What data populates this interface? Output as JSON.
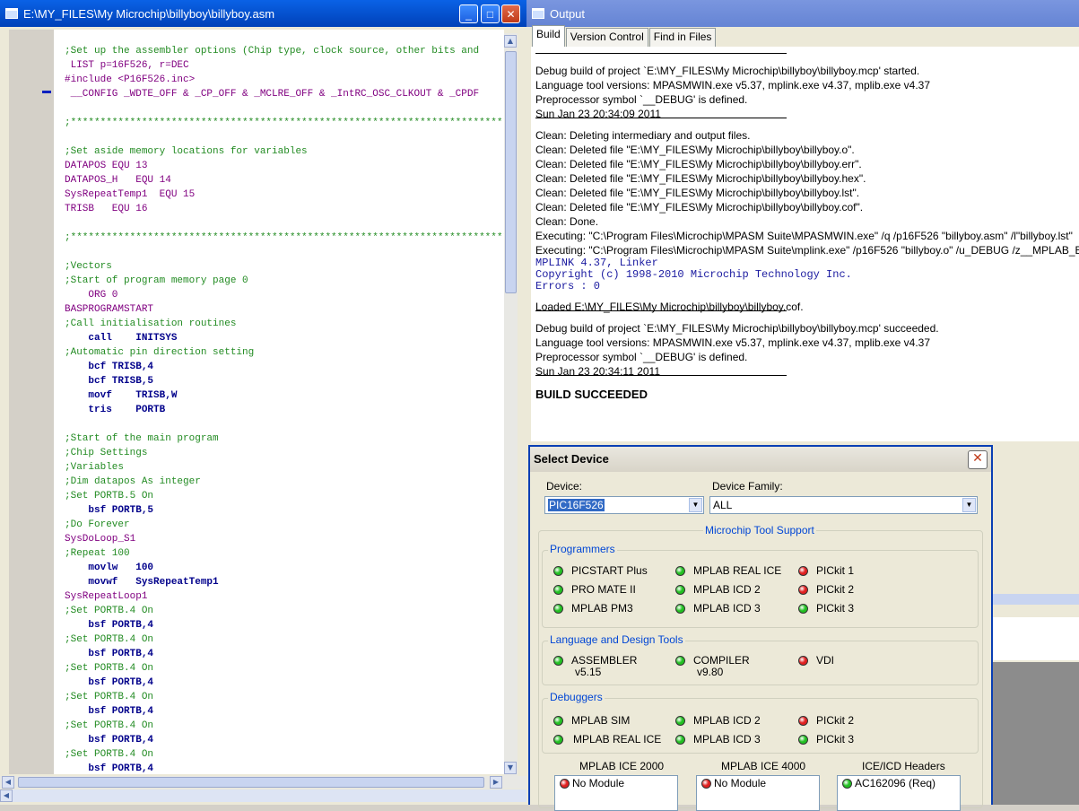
{
  "editor": {
    "title": "E:\\MY_FILES\\My Microchip\\billyboy\\billyboy.asm",
    "lines": [
      {
        "text": ";Set up the assembler options (Chip type, clock source, other bits and",
        "style": "cmt"
      },
      {
        "text": " LIST p=16F526, r=DEC",
        "style": "pp"
      },
      {
        "text": "#include <P16F526.inc>",
        "style": "pp"
      },
      {
        "text": " __CONFIG _WDTE_OFF & _CP_OFF & _MCLRE_OFF & _IntRC_OSC_CLKOUT & _CPDF",
        "style": "pp"
      },
      {
        "text": "",
        "style": "nm"
      },
      {
        "text": ";******************************************************************************",
        "style": "cmt"
      },
      {
        "text": "",
        "style": "nm"
      },
      {
        "text": ";Set aside memory locations for variables",
        "style": "cmt"
      },
      {
        "text": "DATAPOS EQU 13",
        "style": "pp"
      },
      {
        "text": "DATAPOS_H   EQU 14",
        "style": "pp"
      },
      {
        "text": "SysRepeatTemp1  EQU 15",
        "style": "pp"
      },
      {
        "text": "TRISB   EQU 16",
        "style": "pp"
      },
      {
        "text": "",
        "style": "nm"
      },
      {
        "text": ";******************************************************************************",
        "style": "cmt"
      },
      {
        "text": "",
        "style": "nm"
      },
      {
        "text": ";Vectors",
        "style": "cmt"
      },
      {
        "text": ";Start of program memory page 0",
        "style": "cmt"
      },
      {
        "text": "    ORG 0",
        "style": "pp"
      },
      {
        "text": "BASPROGRAMSTART",
        "style": "pp"
      },
      {
        "text": ";Call initialisation routines",
        "style": "cmt"
      },
      {
        "text": "    call    INITSYS",
        "style": "kw"
      },
      {
        "text": ";Automatic pin direction setting",
        "style": "cmt"
      },
      {
        "text": "    bcf TRISB,4",
        "style": "kw"
      },
      {
        "text": "    bcf TRISB,5",
        "style": "kw"
      },
      {
        "text": "    movf    TRISB,W",
        "style": "kw"
      },
      {
        "text": "    tris    PORTB",
        "style": "kw"
      },
      {
        "text": "",
        "style": "nm"
      },
      {
        "text": ";Start of the main program",
        "style": "cmt"
      },
      {
        "text": ";Chip Settings",
        "style": "cmt"
      },
      {
        "text": ";Variables",
        "style": "cmt"
      },
      {
        "text": ";Dim datapos As integer",
        "style": "cmt"
      },
      {
        "text": ";Set PORTB.5 On",
        "style": "cmt"
      },
      {
        "text": "    bsf PORTB,5",
        "style": "kw"
      },
      {
        "text": ";Do Forever",
        "style": "cmt"
      },
      {
        "text": "SysDoLoop_S1",
        "style": "pp"
      },
      {
        "text": ";Repeat 100",
        "style": "cmt"
      },
      {
        "text": "    movlw   100",
        "style": "kw"
      },
      {
        "text": "    movwf   SysRepeatTemp1",
        "style": "kw"
      },
      {
        "text": "SysRepeatLoop1",
        "style": "pp"
      },
      {
        "text": ";Set PORTB.4 On",
        "style": "cmt"
      },
      {
        "text": "    bsf PORTB,4",
        "style": "kw"
      },
      {
        "text": ";Set PORTB.4 On",
        "style": "cmt"
      },
      {
        "text": "    bsf PORTB,4",
        "style": "kw"
      },
      {
        "text": ";Set PORTB.4 On",
        "style": "cmt"
      },
      {
        "text": "    bsf PORTB,4",
        "style": "kw"
      },
      {
        "text": ";Set PORTB.4 On",
        "style": "cmt"
      },
      {
        "text": "    bsf PORTB,4",
        "style": "kw"
      },
      {
        "text": ";Set PORTB.4 On",
        "style": "cmt"
      },
      {
        "text": "    bsf PORTB,4",
        "style": "kw"
      },
      {
        "text": ";Set PORTB.4 On",
        "style": "cmt"
      },
      {
        "text": "    bsf PORTB,4",
        "style": "kw"
      }
    ]
  },
  "output": {
    "title": "Output",
    "tabs": [
      "Build",
      "Version Control",
      "Find in Files"
    ],
    "lines": [
      {
        "text": "Debug build of project `E:\\MY_FILES\\My Microchip\\billyboy\\billyboy.mcp' started.",
        "kind": "text"
      },
      {
        "text": "Language tool versions: MPASMWIN.exe v5.37, mplink.exe v4.37, mplib.exe v4.37",
        "kind": "text"
      },
      {
        "text": "Preprocessor symbol `__DEBUG' is defined.",
        "kind": "text"
      },
      {
        "text": "Sun Jan 23 20:34:09 2011",
        "kind": "text"
      },
      {
        "text": "",
        "kind": "sep"
      },
      {
        "text": "Clean: Deleting intermediary and output files.",
        "kind": "text"
      },
      {
        "text": "Clean: Deleted file \"E:\\MY_FILES\\My Microchip\\billyboy\\billyboy.o\".",
        "kind": "text"
      },
      {
        "text": "Clean: Deleted file \"E:\\MY_FILES\\My Microchip\\billyboy\\billyboy.err\".",
        "kind": "text"
      },
      {
        "text": "Clean: Deleted file \"E:\\MY_FILES\\My Microchip\\billyboy\\billyboy.hex\".",
        "kind": "text"
      },
      {
        "text": "Clean: Deleted file \"E:\\MY_FILES\\My Microchip\\billyboy\\billyboy.lst\".",
        "kind": "text"
      },
      {
        "text": "Clean: Deleted file \"E:\\MY_FILES\\My Microchip\\billyboy\\billyboy.cof\".",
        "kind": "text"
      },
      {
        "text": "Clean: Done.",
        "kind": "text"
      },
      {
        "text": "Executing: \"C:\\Program Files\\Microchip\\MPASM Suite\\MPASMWIN.exe\" /q /p16F526 \"billyboy.asm\" /l\"billyboy.lst\"",
        "kind": "text"
      },
      {
        "text": "Executing: \"C:\\Program Files\\Microchip\\MPASM Suite\\mplink.exe\" /p16F526 \"billyboy.o\" /u_DEBUG /z__MPLAB_BUILD=1",
        "kind": "text"
      },
      {
        "text": "MPLINK 4.37, Linker",
        "kind": "mono"
      },
      {
        "text": "Copyright (c) 1998-2010 Microchip Technology Inc.",
        "kind": "mono"
      },
      {
        "text": "Errors    : 0",
        "kind": "mono"
      },
      {
        "text": "",
        "kind": "blank"
      },
      {
        "text": "Loaded E:\\MY_FILES\\My Microchip\\billyboy\\billyboy.cof.",
        "kind": "text"
      },
      {
        "text": "",
        "kind": "sep"
      },
      {
        "text": "Debug build of project `E:\\MY_FILES\\My Microchip\\billyboy\\billyboy.mcp' succeeded.",
        "kind": "text"
      },
      {
        "text": "Language tool versions: MPASMWIN.exe v5.37, mplink.exe v4.37, mplib.exe v4.37",
        "kind": "text"
      },
      {
        "text": "Preprocessor symbol `__DEBUG' is defined.",
        "kind": "text"
      },
      {
        "text": "Sun Jan 23 20:34:11 2011",
        "kind": "text"
      },
      {
        "text": "",
        "kind": "sep"
      },
      {
        "text": "BUILD SUCCEEDED",
        "kind": "bold"
      }
    ]
  },
  "dialog": {
    "title": "Select Device",
    "device_label": "Device:",
    "device_value": "PIC16F526",
    "family_label": "Device Family:",
    "family_value": "ALL",
    "support_title": "Microchip Tool Support",
    "colors": {
      "green": "#22c022",
      "red": "#e02020"
    },
    "programmers": {
      "title": "Programmers",
      "items": [
        {
          "name": "PICSTART Plus",
          "status": "green"
        },
        {
          "name": "MPLAB REAL ICE",
          "status": "green"
        },
        {
          "name": "PICkit 1",
          "status": "red"
        },
        {
          "name": "PRO MATE II",
          "status": "green"
        },
        {
          "name": "MPLAB ICD 2",
          "status": "green"
        },
        {
          "name": "PICkit 2",
          "status": "red"
        },
        {
          "name": "MPLAB PM3",
          "status": "green"
        },
        {
          "name": "MPLAB ICD 3",
          "status": "green"
        },
        {
          "name": "PICkit 3",
          "status": "green"
        }
      ]
    },
    "language": {
      "title": "Language and Design Tools",
      "items": [
        {
          "name": "ASSEMBLER",
          "version": "v5.15",
          "status": "green"
        },
        {
          "name": "COMPILER",
          "version": "v9.80",
          "status": "green"
        },
        {
          "name": "VDI",
          "version": "",
          "status": "red"
        }
      ]
    },
    "debuggers": {
      "title": "Debuggers",
      "items": [
        {
          "name": "MPLAB SIM",
          "status": "green"
        },
        {
          "name": "MPLAB ICD 2",
          "status": "green"
        },
        {
          "name": "PICkit 2",
          "status": "red"
        },
        {
          "name": "MPLAB REAL ICE",
          "status": "green"
        },
        {
          "name": "MPLAB ICD 3",
          "status": "green"
        },
        {
          "name": "PICkit 3",
          "status": "green"
        }
      ]
    },
    "modules": [
      {
        "header": "MPLAB ICE 2000",
        "value": "No Module",
        "status": "red"
      },
      {
        "header": "MPLAB ICE 4000",
        "value": "No Module",
        "status": "red"
      },
      {
        "header": "ICE/ICD Headers",
        "value": "AC162096 (Req)",
        "status": "green"
      }
    ]
  }
}
